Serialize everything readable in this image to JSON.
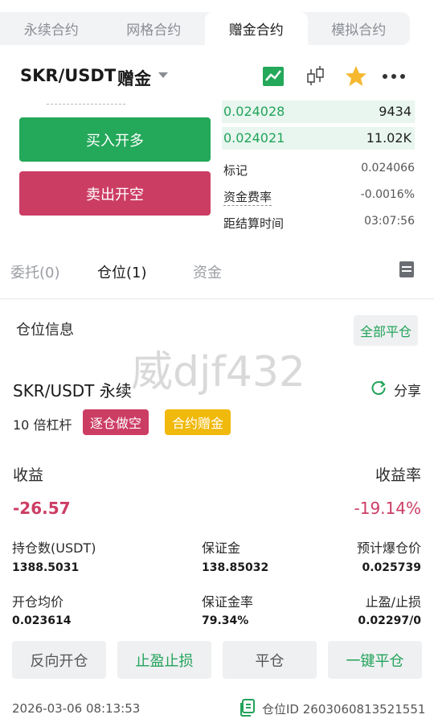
{
  "tabs": [
    "永续合约",
    "网格合约",
    "赠金合约",
    "模拟合约"
  ],
  "active_tab": 2,
  "header": {
    "pair": "SKR/USDT",
    "tag": "赠金"
  },
  "colors": {
    "green": "#24a85a",
    "red": "#cc3d64",
    "yellow": "#f0b90b"
  },
  "buttons": {
    "buy": "买入开多",
    "sell": "卖出开空"
  },
  "orderbook": [
    {
      "price": "0.024028",
      "qty": "9434"
    },
    {
      "price": "0.024021",
      "qty": "11.02K"
    }
  ],
  "market_info": [
    {
      "label": "标记",
      "value": "0.024066"
    },
    {
      "label": "资金费率",
      "value": "-0.0016%"
    },
    {
      "label": "距结算时间",
      "value": "03:07:56"
    }
  ],
  "section_tabs": [
    "委托(0)",
    "仓位(1)",
    "资金"
  ],
  "position": {
    "title": "仓位信息",
    "close_all": "全部平仓",
    "watermark": "威djf432",
    "contract": "SKR/USDT 永续",
    "share": "分享",
    "leverage": "10 倍杠杆",
    "badge_side": "逐仓做空",
    "badge_bonus": "合约赠金",
    "pnl_label": "收益",
    "pnl_value": "-26.57",
    "roi_label": "收益率",
    "roi_value": "-19.14%",
    "stats": [
      {
        "label": "持仓数(USDT)",
        "value": "1388.5031"
      },
      {
        "label": "保证金",
        "value": "138.85032"
      },
      {
        "label": "预计爆仓价",
        "value": "0.025739"
      },
      {
        "label": "开仓均价",
        "value": "0.023614"
      },
      {
        "label": "保证金率",
        "value": "79.34%"
      },
      {
        "label": "止盈/止损",
        "value": "0.02297/0"
      }
    ],
    "actions": [
      "反向开仓",
      "止盈止损",
      "平仓",
      "一键平仓"
    ],
    "time": "2026-03-06 08:13:53",
    "position_id": "仓位ID 2603060813521551"
  }
}
